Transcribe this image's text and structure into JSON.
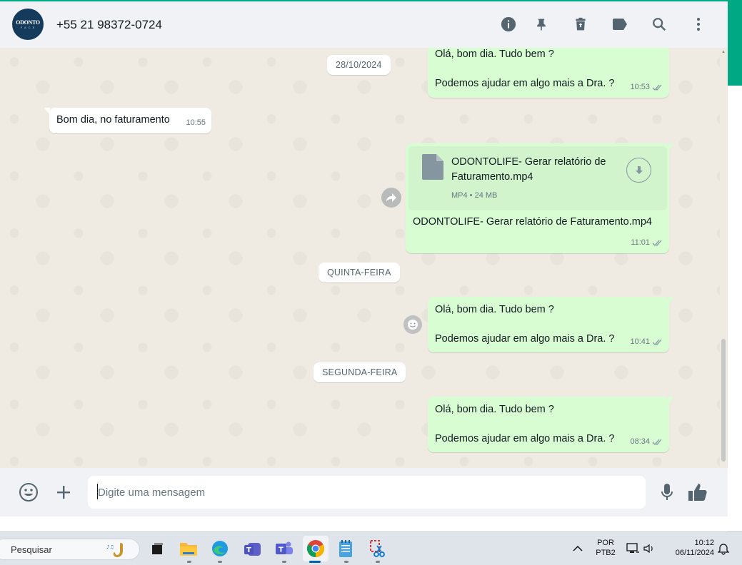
{
  "header": {
    "contact_name": "+55 21 98372-0724",
    "avatar_text_top": "ODONTO",
    "avatar_text_bottom": "F A C E",
    "icons": [
      "info-icon",
      "pin-icon",
      "delete-icon",
      "label-icon",
      "search-icon",
      "menu-icon"
    ]
  },
  "chat": {
    "dates": [
      "28/10/2024",
      "QUINTA-FEIRA",
      "SEGUNDA-FEIRA"
    ],
    "messages": [
      {
        "dir": "out",
        "line1": "Olá, bom dia. Tudo bem ?",
        "line2": "Podemos ajudar em algo mais a Dra. ?",
        "time": "10:53",
        "status": "read"
      },
      {
        "dir": "in",
        "text": "Bom dia, no faturamento",
        "time": "10:55"
      },
      {
        "dir": "out",
        "file_name": "ODONTOLIFE- Gerar relatório de Faturamento.mp4",
        "file_meta": "MP4 • 24 MB",
        "caption": "ODONTOLIFE- Gerar relatório de Faturamento.mp4",
        "time": "11:01",
        "status": "read"
      },
      {
        "dir": "out",
        "line1": "Olá, bom dia. Tudo bem ?",
        "line2": "Podemos ajudar em algo mais a Dra. ?",
        "time": "10:41",
        "status": "read"
      },
      {
        "dir": "out",
        "line1": "Olá, bom dia. Tudo bem ?",
        "line2": "Podemos ajudar em algo mais a Dra. ?",
        "time": "08:34",
        "status": "read"
      }
    ]
  },
  "composer": {
    "placeholder": "Digite uma mensagem",
    "icons": [
      "emoji-icon",
      "plus-icon",
      "mic-icon",
      "thumbs-up-icon"
    ]
  },
  "taskbar": {
    "search_placeholder": "Pesquisar",
    "apps": [
      "task-view-icon",
      "file-explorer-icon",
      "edge-icon",
      "teams-icon",
      "teams-classic-icon",
      "chrome-icon",
      "notepad-icon",
      "snipping-tool-icon"
    ],
    "language_top": "POR",
    "language_bottom": "PTB2",
    "time": "10:12",
    "date": "06/11/2024"
  },
  "colors": {
    "accent": "#00a884",
    "outgoing_bubble": "#d9fdd3",
    "incoming_bubble": "#ffffff",
    "chat_bg": "#efeae2",
    "header_bg": "#f0f2f5"
  }
}
